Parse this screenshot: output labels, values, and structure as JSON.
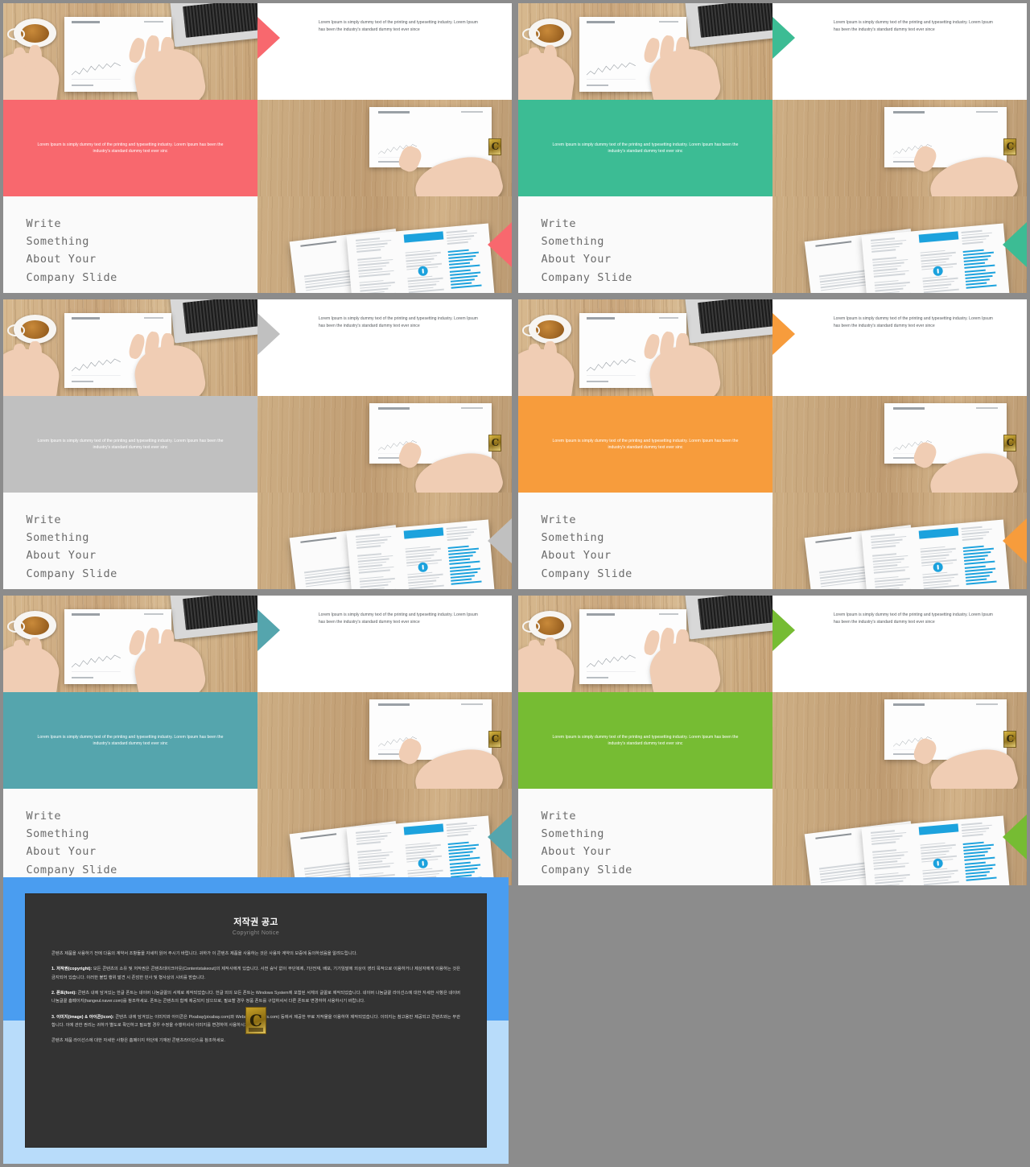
{
  "deck": {
    "body_copy": "Lorem Ipsum is simply dummy text of the printing and typesetting industry. Lorem Ipsum has been the industry's standard dummy text ever since",
    "accent_copy": "Lorem Ipsum is simply dummy text of the printing and typesetting industry. Lorem Ipsum has been the industry's standard dummy text ever sinc",
    "headline": "Write\nSomething\nAbout Your\nCompany Slide",
    "watermark_letter": "C"
  },
  "slides": [
    {
      "id": "slide-coral",
      "accent_name": "coral",
      "color": "#F8686E"
    },
    {
      "id": "slide-green",
      "accent_name": "green",
      "color": "#3CBC94"
    },
    {
      "id": "slide-gray",
      "accent_name": "gray",
      "color": "#C0C0C0"
    },
    {
      "id": "slide-orange",
      "accent_name": "orange",
      "color": "#F79C3C"
    },
    {
      "id": "slide-teal",
      "accent_name": "teal",
      "color": "#55A5AD"
    },
    {
      "id": "slide-lime",
      "accent_name": "lime",
      "color": "#76BC33"
    }
  ],
  "notice": {
    "title": "저작권 공고",
    "subtitle": "Copyright Notice",
    "intro": "콘텐츠 제품을 사용하기 전에 다음의 계약서 조항들을 자세히 읽어 주시기 바랍니다. 귀하가 이 콘텐츠 제품을 사용하는 것은 사용자 계약의 보증에 동의하셨음을 알려드립니다.",
    "item1_label": "1. 저작권(copyright):",
    "item1_text": " 모든 콘텐츠의 소유 및 저작권은 콘텐츠테이크아웃(Contentstakeout)의 제작사에게 있습니다. 사전 승낙 없이 무단복제, 7단전재, 배포, 기기임말에 외상이 영리 목적으로 이용하거나 제삼자에게 이용하는 것은 금지되어 있습니다. 이러한 불법 행위 발견 시 존엄한 민사 및 형사상의 시비를 받습니다.",
    "item2_label": "2. 폰트(font):",
    "item2_text": " 콘텐츠 내에 담겨있는 한글 폰트는 네이버 나눔글꼴의 서체로 제작되었습니다. 한글 외의 모든 폰트는 Windows System에 포함된 서체의 글꼴로 제작되었습니다. 네이버 나눔글꼴 라이선스에 대한 자세한 사항은 네이버 나눔글꼴 홈페이지(hangeul.naver.com)를 참조하세요. 폰트는 콘텐츠의 함께 제공되지 않으므로, 필요할 경우 정품 폰트를 구입하셔서 다른 폰트로 변경하여 사용하시기 바랍니다.",
    "item3_label": "3. 이미지(image) & 아이콘(icon):",
    "item3_text": " 콘텐츠 내에 담겨있는 이미지와 아이콘은 Pixabay(pixabay.com)와 Webalys(webalys.com) 등에서 제공한 무료 저작물을 이용하여 제작되었습니다. 이미지는 참고용만 제공되고 콘텐츠와는 무관합니다. 이에 관한 권리는 귀하가 별도로 확인하고 필요할 경우 수정을 수행하셔서 이미지를 변경하여 사용하시기 바랍니다.",
    "outro": "콘텐츠 제품 라이선스에 대한 자세한 사항은 홈페이지 하단에 기재된 콘텐츠라이선스를 참조하세요."
  }
}
